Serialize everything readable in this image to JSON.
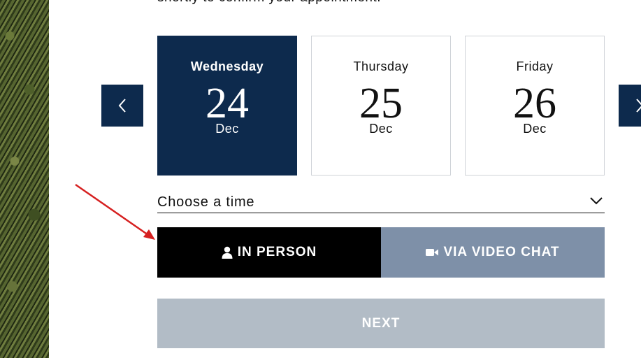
{
  "intro": {
    "text": "shortly to confirm your appointment."
  },
  "date_picker": {
    "days": [
      {
        "weekday": "Wednesday",
        "day": "24",
        "month": "Dec",
        "selected": true
      },
      {
        "weekday": "Thursday",
        "day": "25",
        "month": "Dec",
        "selected": false
      },
      {
        "weekday": "Friday",
        "day": "26",
        "month": "Dec",
        "selected": false
      }
    ],
    "prev_icon": "chevron-left-icon",
    "next_icon": "chevron-right-icon"
  },
  "time": {
    "label": "Choose a time"
  },
  "mode": {
    "in_person_label": "IN PERSON",
    "video_label": "VIA VIDEO CHAT",
    "selected": "in_person"
  },
  "next_label": "NEXT",
  "colors": {
    "navy": "#0d2a4d",
    "black": "#000000",
    "slate": "#7e90a8",
    "disabled": "#b2bcc6",
    "annotation_arrow": "#d62020"
  }
}
